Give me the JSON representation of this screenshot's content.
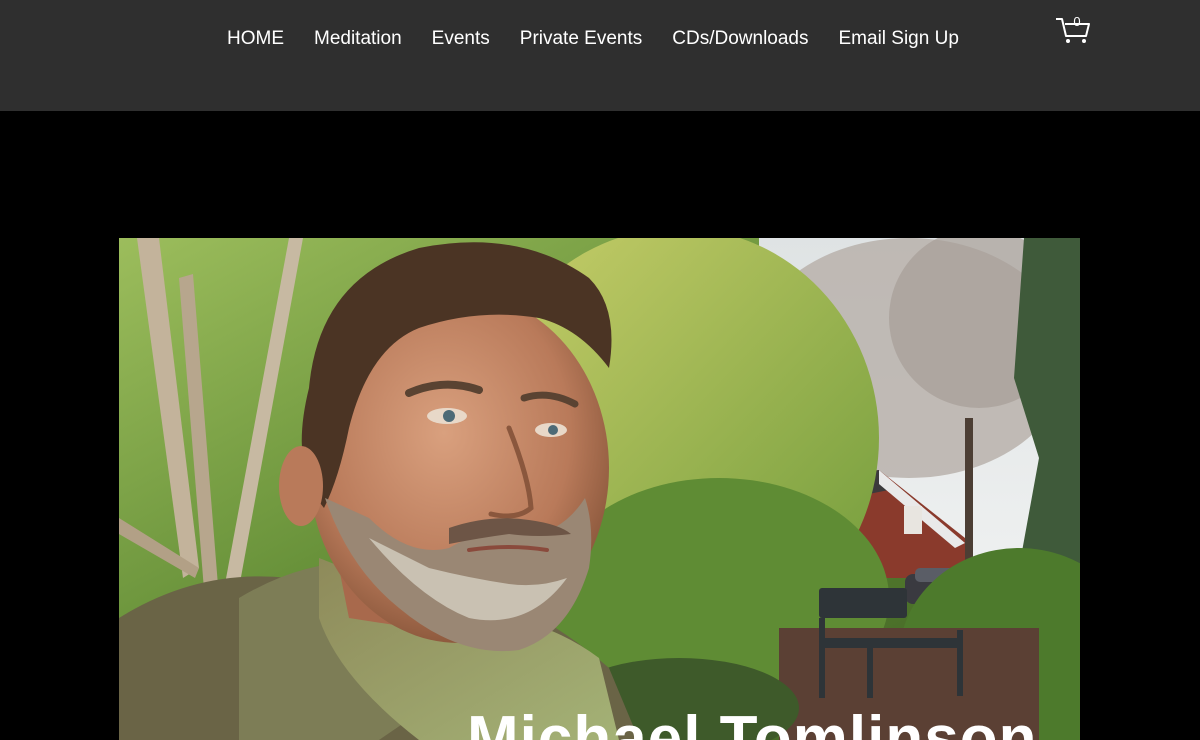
{
  "nav": {
    "items": [
      {
        "label": "HOME"
      },
      {
        "label": "Meditation"
      },
      {
        "label": "Events"
      },
      {
        "label": "Private Events"
      },
      {
        "label": "CDs/Downloads"
      },
      {
        "label": "Email Sign Up"
      }
    ]
  },
  "cart": {
    "count": "0",
    "icon": "cart-icon"
  },
  "hero": {
    "title": "Michael Tomlinson"
  },
  "colors": {
    "header_bg": "#2f2f2f",
    "page_bg": "#000000",
    "nav_text": "#ffffff"
  }
}
